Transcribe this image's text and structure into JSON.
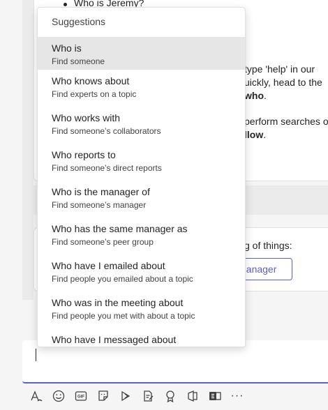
{
  "background": {
    "bullet": "Who is Jeremy?",
    "line1": "type 'help' in our",
    "line2": "uickly, head to the",
    "line3_text": "",
    "line3_bold": "who",
    "line3_end": ".",
    "line4": "perform searches o",
    "line5_bold": "llow",
    "line5_end": ".",
    "line6": "g of things:",
    "button_label": "nanager"
  },
  "dropdown": {
    "header": "Suggestions",
    "items": [
      {
        "title": "Who is",
        "subtitle": "Find someone"
      },
      {
        "title": "Who knows about",
        "subtitle": "Find experts on a topic"
      },
      {
        "title": "Who works with",
        "subtitle": "Find someone’s collaborators"
      },
      {
        "title": "Who reports to",
        "subtitle": "Find someone’s direct reports"
      },
      {
        "title": "Who is the manager of",
        "subtitle": "Find someone’s manager"
      },
      {
        "title": "Who has the same manager as",
        "subtitle": "Find someone’s peer group"
      },
      {
        "title": "Who have I emailed about",
        "subtitle": "Find people you emailed about a topic"
      },
      {
        "title": "Who was in the meeting about",
        "subtitle": "Find people you met with about a topic"
      },
      {
        "title": "Who have I messaged about",
        "subtitle": ""
      }
    ]
  },
  "toolbar": {
    "gif_label": "GIF",
    "more_label": "···",
    "icons": [
      "format-icon",
      "emoji-icon",
      "gif-icon",
      "sticker-icon",
      "schedule-meeting-icon",
      "loop-icon",
      "praise-icon",
      "onenote-icon",
      "forms-icon",
      "more-icon"
    ]
  },
  "colors": {
    "accent": "#5b5fc7",
    "active_item": "#e6e6e6"
  }
}
